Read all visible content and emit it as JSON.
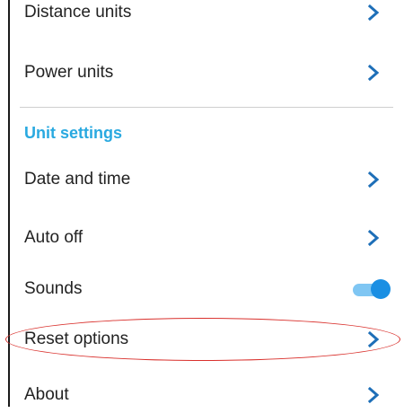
{
  "settings": {
    "rows_top": [
      {
        "label": "Distance units",
        "icon": "chevron-right-icon"
      },
      {
        "label": "Power units",
        "icon": "chevron-right-icon"
      }
    ],
    "section": {
      "title": "Unit settings"
    },
    "rows_unit": [
      {
        "label": "Date and time",
        "icon": "chevron-right-icon"
      },
      {
        "label": "Auto off",
        "icon": "chevron-right-icon"
      },
      {
        "label": "Sounds",
        "control": "toggle",
        "toggle_on": true
      },
      {
        "label": "Reset options",
        "icon": "chevron-right-icon",
        "highlighted": true
      },
      {
        "label": "About",
        "icon": "chevron-right-icon"
      }
    ]
  },
  "colors": {
    "accent": "#29a9e0",
    "chevron": "#1e6fb8",
    "toggle_thumb": "#1a8fe3",
    "toggle_track": "#7fc6f3",
    "highlight_outline": "#d9302c"
  }
}
